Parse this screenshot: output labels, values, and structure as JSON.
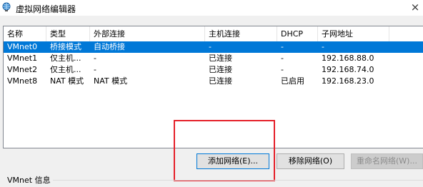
{
  "window": {
    "title": "虚拟网络编辑器",
    "close_glyph": "×"
  },
  "table": {
    "columns": [
      "名称",
      "类型",
      "外部连接",
      "主机连接",
      "DHCP",
      "子网地址"
    ],
    "rows": [
      {
        "name": "VMnet0",
        "type": "桥接模式",
        "external": "自动桥接",
        "host": "-",
        "dhcp": "-",
        "subnet": "-",
        "selected": true
      },
      {
        "name": "VMnet1",
        "type": "仅主机...",
        "external": "-",
        "host": "已连接",
        "dhcp": "-",
        "subnet": "192.168.88.0",
        "selected": false
      },
      {
        "name": "VMnet2",
        "type": "仅主机...",
        "external": "-",
        "host": "已连接",
        "dhcp": "-",
        "subnet": "192.168.74.0",
        "selected": false
      },
      {
        "name": "VMnet8",
        "type": "NAT 模式",
        "external": "NAT 模式",
        "host": "已连接",
        "dhcp": "已启用",
        "subnet": "192.168.23.0",
        "selected": false
      }
    ]
  },
  "buttons": {
    "add": "添加网络(E)...",
    "remove": "移除网络(O)",
    "rename": "重命名网络(W)..."
  },
  "group": {
    "label": "VMnet 信息"
  },
  "colors": {
    "selection": "#0078d7",
    "highlight": "#e5202a"
  }
}
